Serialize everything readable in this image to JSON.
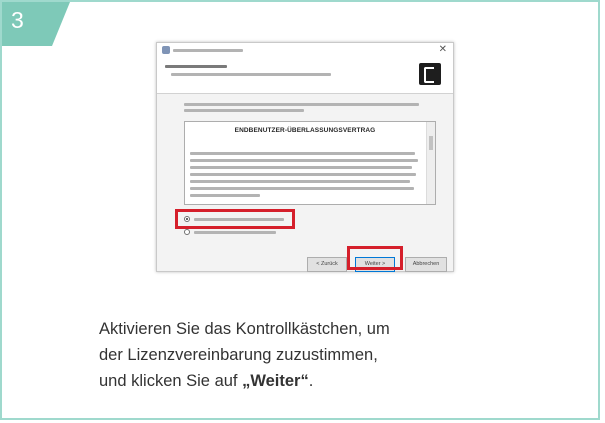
{
  "step": {
    "number": "3",
    "color": "#7ec9b8"
  },
  "dialog": {
    "license_title": "ENDBENUTZER-ÜBERLASSUNGSVERTRAG",
    "buttons": {
      "back": "< Zurück",
      "next": "Weiter >",
      "cancel": "Abbrechen"
    },
    "radio_accept_selected": true
  },
  "instruction": {
    "line1": "Aktivieren Sie das Kontrollkästchen, um",
    "line2": "der Lizenzvereinbarung zuzustimmen,",
    "line3_prefix": "und klicken Sie auf ",
    "line3_bold": "„Weiter“",
    "line3_suffix": "."
  },
  "colors": {
    "card_border": "#9fd9cd",
    "highlight": "#d51f2b",
    "text": "#333333"
  }
}
